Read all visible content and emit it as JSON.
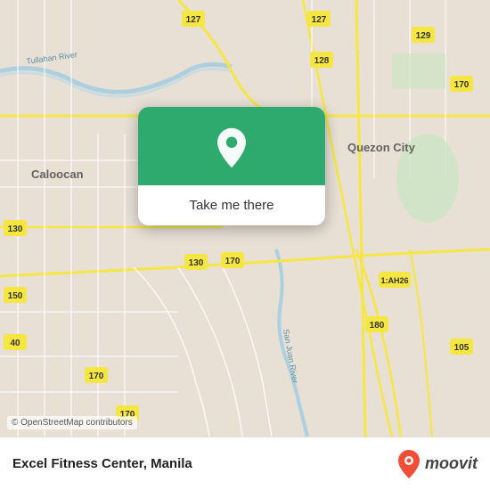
{
  "map": {
    "attribution": "© OpenStreetMap contributors",
    "background_color": "#e8e0d8"
  },
  "popup": {
    "button_label": "Take me there",
    "pin_icon": "location-pin-icon"
  },
  "bottom_bar": {
    "location_name": "Excel Fitness Center, Manila",
    "credit": "© OpenStreetMap contributors",
    "moovit_label": "moovit"
  },
  "labels": {
    "caloocan": "Caloocan",
    "quezon_city": "Quezon City",
    "road_127_1": "127",
    "road_127_2": "127",
    "road_128": "128",
    "road_129": "129",
    "road_130_1": "130",
    "road_130_2": "130",
    "road_170_1": "170",
    "road_170_2": "170",
    "road_170_3": "170",
    "road_150": "150",
    "road_105": "105",
    "road_180": "180",
    "road_1ah26": "1:AH26",
    "road_40": "40",
    "tullahan_river": "Tullahan River",
    "san_juan_river": "San Juan River"
  }
}
